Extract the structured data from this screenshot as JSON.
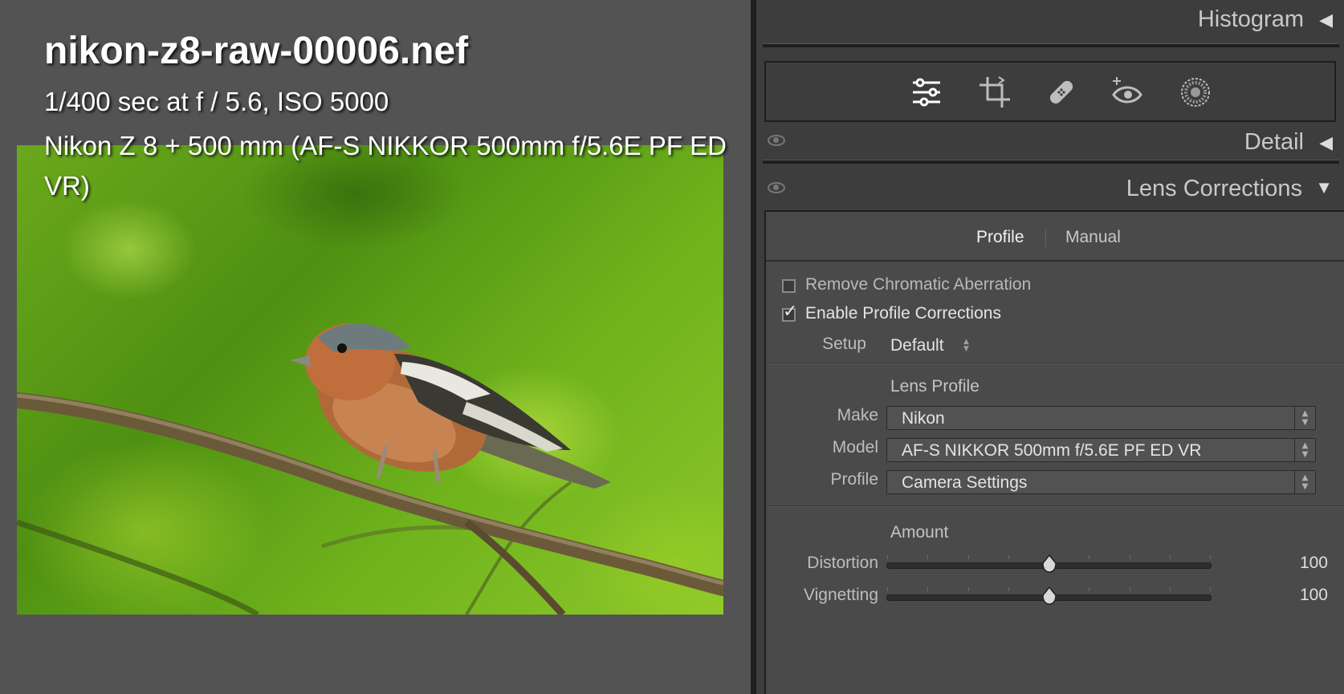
{
  "viewer": {
    "file_name": "nikon-z8-raw-00006.nef",
    "exposure": "1/400 sec at f / 5.6, ISO 5000",
    "lens": "Nikon Z 8 + 500 mm (AF-S NIKKOR 500mm f/5.6E PF ED VR)"
  },
  "panel": {
    "histogram_header": "Histogram",
    "detail_header": "Detail",
    "lens_corrections_header": "Lens Corrections",
    "tools": [
      "adjustments-icon",
      "crop-icon",
      "healing-icon",
      "red-eye-icon",
      "mask-icon"
    ],
    "tabs": {
      "profile": "Profile",
      "manual": "Manual"
    },
    "options": {
      "remove_ca_label": "Remove Chromatic Aberration",
      "remove_ca_checked": false,
      "enable_profile_label": "Enable Profile Corrections",
      "enable_profile_checked": true
    },
    "setup": {
      "label": "Setup",
      "value": "Default"
    },
    "lens_profile": {
      "title": "Lens Profile",
      "make_label": "Make",
      "make_value": "Nikon",
      "model_label": "Model",
      "model_value": "AF-S NIKKOR 500mm f/5.6E PF ED VR",
      "profile_label": "Profile",
      "profile_value": "Camera Settings"
    },
    "amount": {
      "title": "Amount",
      "distortion_label": "Distortion",
      "distortion_value": "100",
      "distortion_fraction": 0.5,
      "vignetting_label": "Vignetting",
      "vignetting_value": "100",
      "vignetting_fraction": 0.5
    }
  },
  "colors": {
    "viewer_bg": "#535353",
    "panel_bg": "#3d3d3d",
    "photo_green": "#5a9a18"
  }
}
